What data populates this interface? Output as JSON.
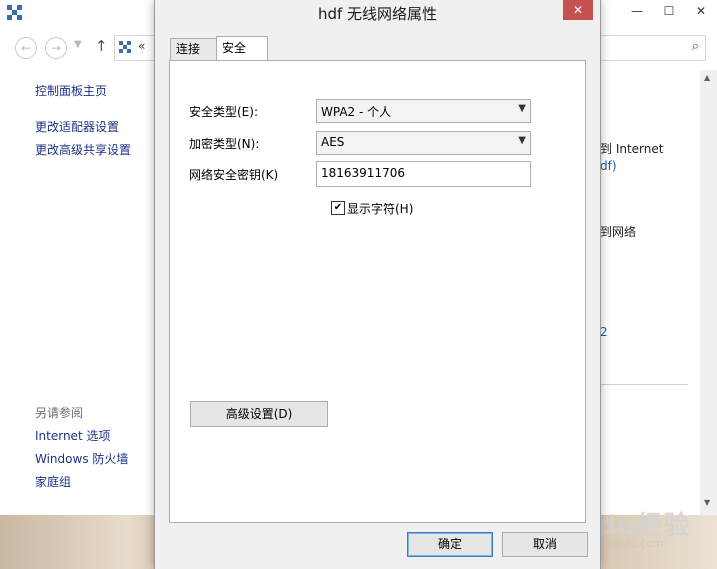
{
  "explorer": {
    "left_pane": {
      "home_link": "控制面板主页",
      "links": [
        "更改适配器设置",
        "更改高级共享设置"
      ],
      "see_also_heading": "另请参阅",
      "see_also_links": [
        "Internet 选项",
        "Windows 防火墙",
        "家庭组"
      ]
    },
    "address_chevron": "«",
    "right_pane_fragments": [
      "到 Internet",
      "df)",
      "到网络",
      "2"
    ]
  },
  "dialog": {
    "title": "hdf 无线网络属性",
    "close_glyph": "✕",
    "tabs": [
      "连接",
      "安全"
    ],
    "active_tab": "安全",
    "security": {
      "security_type_label": "安全类型(E):",
      "security_type_value": "WPA2 - 个人",
      "encryption_type_label": "加密类型(N):",
      "encryption_type_value": "AES",
      "key_label": "网络安全密钥(K)",
      "key_value": "18163911706",
      "show_chars_label": "显示字符(H)",
      "show_chars_checked": true,
      "advanced_button": "高级设置(D)"
    },
    "ok_button": "确定",
    "cancel_button": "取消"
  },
  "watermark": {
    "main": "Baidu经验",
    "sub": "jingyan.baidu.com"
  },
  "colors": {
    "close_button": "#c75050",
    "link": "#1e3287",
    "dialog_bg": "#f0f0f0"
  }
}
